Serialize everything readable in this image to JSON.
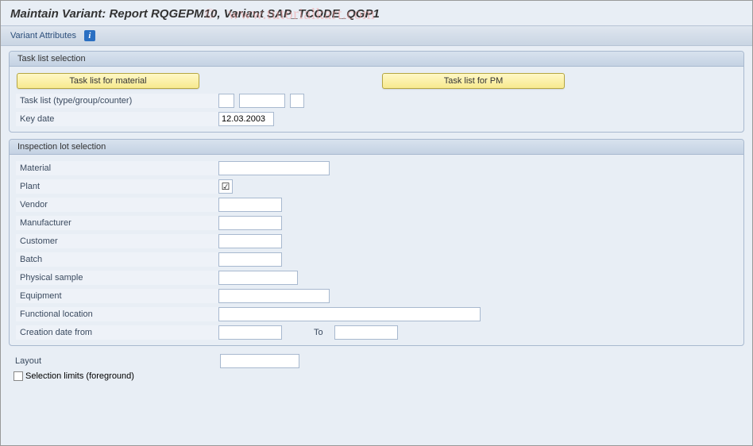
{
  "watermark": {
    "copyright": "©",
    "text": "www.tutorialkart.com"
  },
  "title": "Maintain Variant: Report RQGEPM10, Variant SAP_TCODE_QGP1",
  "toolbar": {
    "variant_attributes_label": "Variant Attributes",
    "info_icon": "i"
  },
  "groups": {
    "task_list": {
      "title": "Task list selection",
      "buttons": {
        "material": "Task list for material",
        "pm": "Task list for PM"
      },
      "fields": {
        "task_list_type_label": "Task list (type/group/counter)",
        "type_val": "",
        "group_val": "",
        "counter_checked": false,
        "key_date_label": "Key date",
        "key_date_val": "12.03.2003"
      }
    },
    "inspection": {
      "title": "Inspection lot selection",
      "fields": {
        "material_label": "Material",
        "material_val": "",
        "plant_label": "Plant",
        "plant_checked": true,
        "vendor_label": "Vendor",
        "vendor_val": "",
        "manufacturer_label": "Manufacturer",
        "manufacturer_val": "",
        "customer_label": "Customer",
        "customer_val": "",
        "batch_label": "Batch",
        "batch_val": "",
        "sample_label": "Physical sample",
        "sample_val": "",
        "equipment_label": "Equipment",
        "equipment_val": "",
        "funcloc_label": "Functional location",
        "funcloc_val": "",
        "creation_label": "Creation date from",
        "creation_from": "",
        "to_label": "To",
        "creation_to": ""
      }
    }
  },
  "footer": {
    "layout_label": "Layout",
    "layout_val": "",
    "selection_limits_label": "Selection limits (foreground)",
    "selection_limits_checked": false
  }
}
